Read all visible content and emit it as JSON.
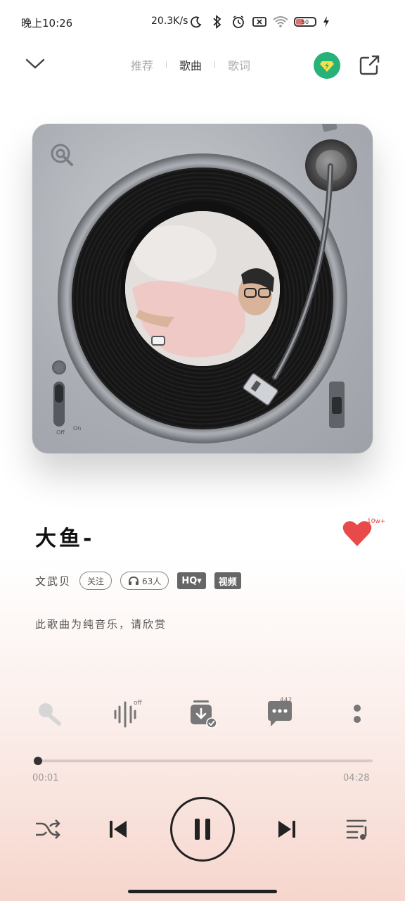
{
  "status_bar": {
    "time": "晚上10:26",
    "net_speed": "20.3K/s",
    "battery_level": "50"
  },
  "nav": {
    "tabs": [
      {
        "label": "推荐",
        "active": false
      },
      {
        "label": "歌曲",
        "active": true
      },
      {
        "label": "歌词",
        "active": false
      }
    ]
  },
  "turntable": {
    "switch_off_label": "Off",
    "switch_on_label": "On"
  },
  "song": {
    "title": "大鱼-",
    "like_count": "10w+",
    "artist": "文武贝",
    "follow_label": "关注",
    "listeners": "63人",
    "quality_label": "HQ▾",
    "video_label": "视频",
    "description": "此歌曲为纯音乐，请欣赏"
  },
  "actions": {
    "sound_effect_badge": "off",
    "comment_count": "442"
  },
  "player": {
    "current_time": "00:01",
    "total_time": "04:28",
    "progress": 0.004
  },
  "colors": {
    "vip_green": "#27b27a",
    "heart_red": "#e84a4a",
    "gradient_bottom": "#f6d6cd"
  }
}
